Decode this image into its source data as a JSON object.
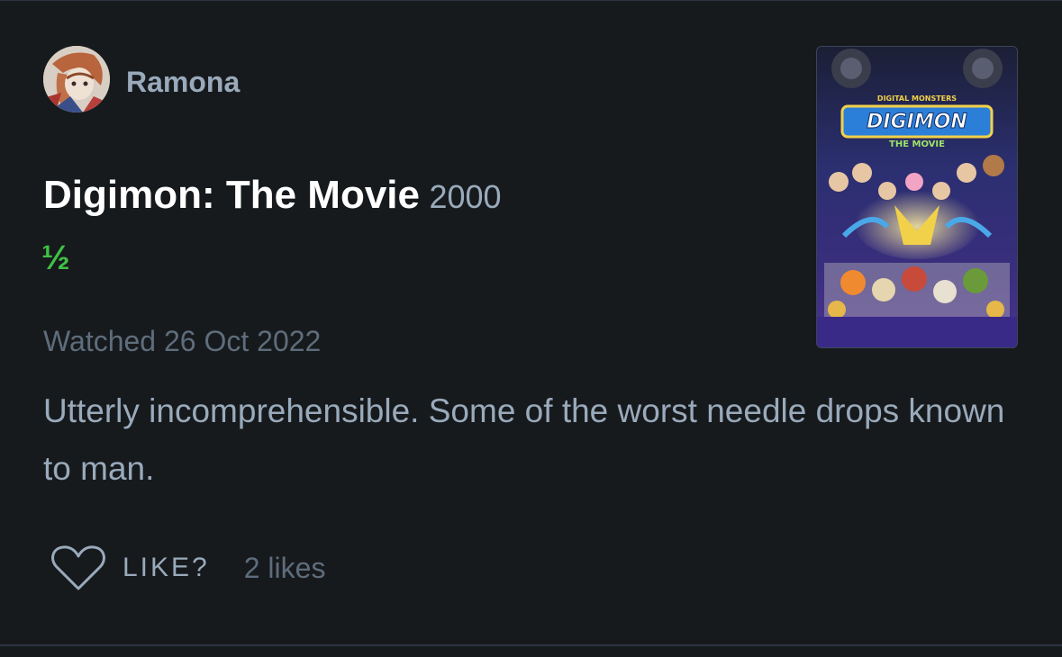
{
  "review": {
    "user": {
      "name": "Ramona",
      "avatar_icon": "avatar-image"
    },
    "film": {
      "title": "Digimon: The Movie",
      "year": "2000"
    },
    "rating": "½",
    "watched": "Watched 26 Oct 2022",
    "text": "Utterly incomprehensible. Some of the worst needle drops known to man.",
    "actions": {
      "like_label": "LIKE?",
      "likes_count": "2 likes",
      "like_icon": "heart-icon"
    },
    "poster": {
      "logo_top": "DIGITAL MONSTERS",
      "logo_main": "DIGIMON",
      "logo_sub": "THE MOVIE"
    }
  },
  "colors": {
    "background": "#171a1d",
    "muted_text": "#99aabb",
    "faint_text": "#5e6d7c",
    "rating_green": "#40c045",
    "title_white": "#ffffff"
  }
}
